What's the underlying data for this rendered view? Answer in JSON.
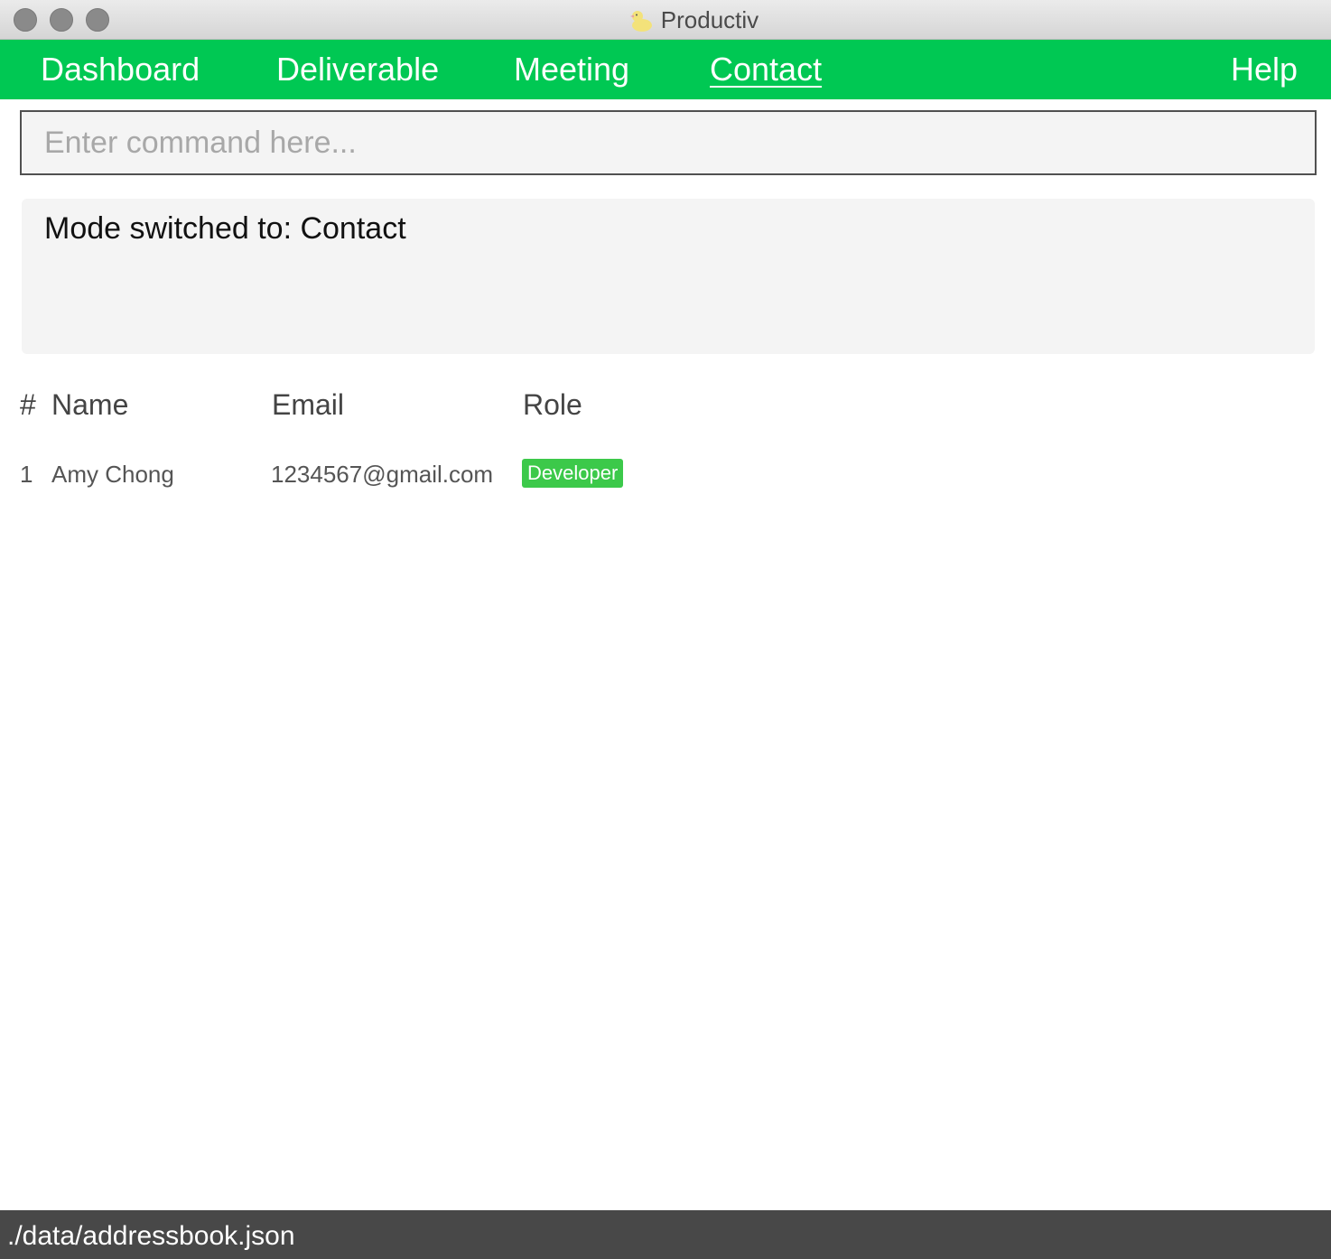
{
  "window": {
    "title": "Productiv",
    "app_icon": "rubber-duck-icon"
  },
  "nav": {
    "dashboard": "Dashboard",
    "deliverable": "Deliverable",
    "meeting": "Meeting",
    "contact": "Contact",
    "help": "Help",
    "active": "Contact"
  },
  "command": {
    "placeholder": "Enter command here...",
    "value": ""
  },
  "result": {
    "message": "Mode switched to: Contact"
  },
  "contacts": {
    "headers": {
      "index": "#",
      "name": "Name",
      "email": "Email",
      "role": "Role"
    },
    "rows": [
      {
        "index": "1",
        "name": "Amy Chong",
        "email": "1234567@gmail.com",
        "role": "Developer"
      }
    ]
  },
  "status": {
    "path": "./data/addressbook.json"
  },
  "colors": {
    "nav_bg": "#00c853",
    "role_tag": "#3cc94a",
    "status_bg": "#484848"
  }
}
